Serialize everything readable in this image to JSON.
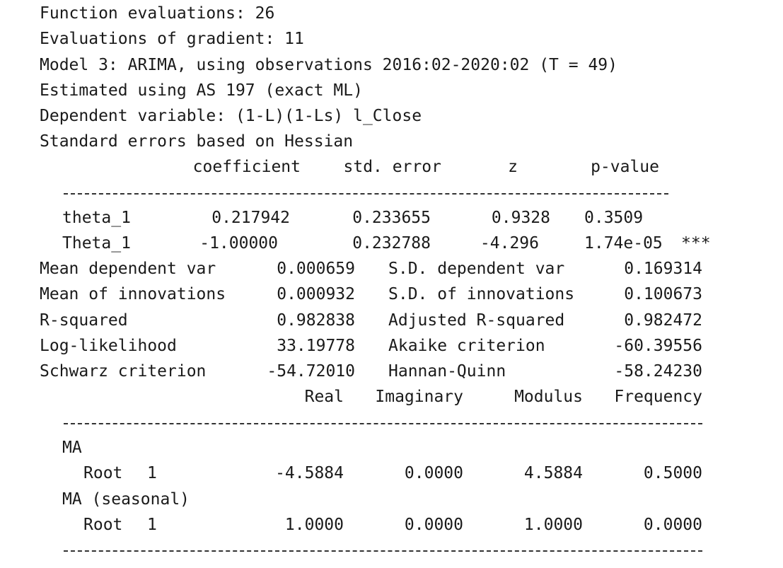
{
  "header_lines": [
    "Function evaluations: 26",
    "Evaluations of gradient: 11",
    "Model 3: ARIMA, using observations 2016:02-2020:02 (T = 49)",
    "Estimated using AS 197 (exact ML)",
    "Dependent variable: (1-L)(1-Ls) l_Close",
    "Standard errors based on Hessian"
  ],
  "coef_table": {
    "headers": [
      "coefficient",
      "std. error",
      "z",
      "p-value"
    ],
    "rows": [
      {
        "name": "theta_1",
        "coef": "0.217942",
        "se": "0.233655",
        "z": "0.9328",
        "p": "0.3509",
        "stars": ""
      },
      {
        "name": "Theta_1",
        "coef": "-1.00000",
        "se": "0.232788",
        "z": "-4.296",
        "p": "1.74e-05",
        "stars": "***"
      }
    ]
  },
  "stats": [
    {
      "l1": "Mean dependent var",
      "v1": "0.000659",
      "l2": "S.D. dependent var",
      "v2": "0.169314"
    },
    {
      "l1": "Mean of innovations",
      "v1": "0.000932",
      "l2": "S.D. of innovations",
      "v2": "0.100673"
    },
    {
      "l1": "R-squared",
      "v1": "0.982838",
      "l2": "Adjusted R-squared",
      "v2": "0.982472"
    },
    {
      "l1": "Log-likelihood",
      "v1": "33.19778",
      "l2": "Akaike criterion",
      "v2": "-60.39556"
    },
    {
      "l1": "Schwarz criterion",
      "v1": "-54.72010",
      "l2": "Hannan-Quinn",
      "v2": "-58.24230"
    }
  ],
  "roots_table": {
    "headers": [
      "Real",
      "Imaginary",
      "Modulus",
      "Frequency"
    ],
    "sections": [
      {
        "title": "MA",
        "root_label": "Root",
        "root_num": "1",
        "real": "-4.5884",
        "imag": "0.0000",
        "modulus": "4.5884",
        "freq": "0.5000"
      },
      {
        "title": "MA (seasonal)",
        "root_label": "Root",
        "root_num": "1",
        "real": "1.0000",
        "imag": "0.0000",
        "modulus": "1.0000",
        "freq": "0.0000"
      }
    ]
  }
}
